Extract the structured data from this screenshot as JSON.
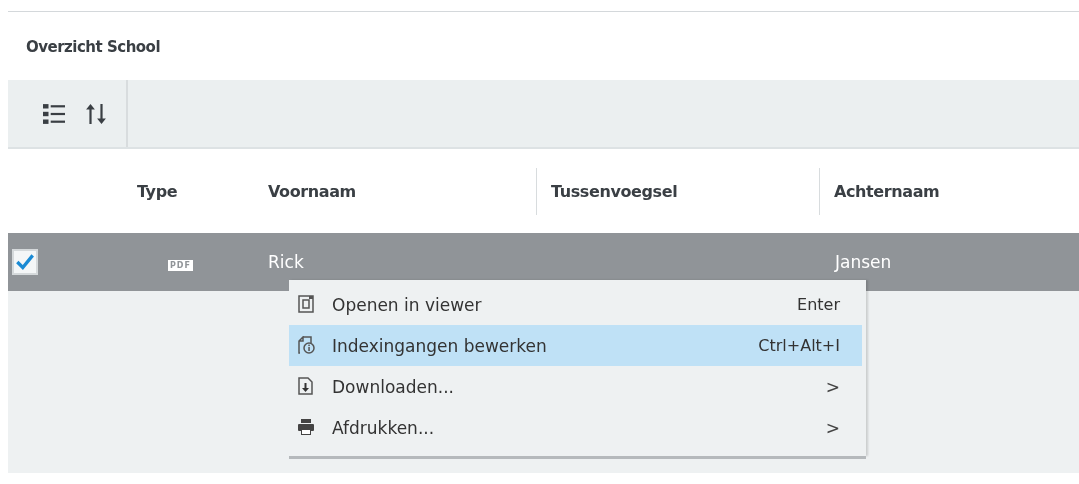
{
  "title": "Overzicht School",
  "toolbar": {
    "buttons": [
      {
        "kind": "list"
      },
      {
        "kind": "sort"
      }
    ]
  },
  "table": {
    "columns": [
      {
        "kind": "type",
        "label": "Type"
      },
      {
        "kind": "text",
        "label": "Voornaam"
      },
      {
        "kind": "text",
        "label": "Tussenvoegsel"
      },
      {
        "kind": "text",
        "label": "Achternaam"
      }
    ],
    "rows": [
      {
        "selected": true,
        "checked": true,
        "cells": [
          "PDF",
          "Rick",
          "",
          "Jansen"
        ]
      }
    ]
  },
  "context_menu": {
    "items": [
      {
        "kind": "shortcut",
        "label": "Openen in viewer",
        "shortcut": "Enter",
        "selected": false
      },
      {
        "kind": "shortcut",
        "label": "Indexingangen bewerken",
        "shortcut": "Ctrl+Alt+I",
        "selected": true
      },
      {
        "kind": "submenu",
        "label": "Downloaden...",
        "arrow": ">",
        "selected": false
      },
      {
        "kind": "submenu",
        "label": "Afdrukken...",
        "arrow": ">",
        "selected": false
      }
    ]
  }
}
